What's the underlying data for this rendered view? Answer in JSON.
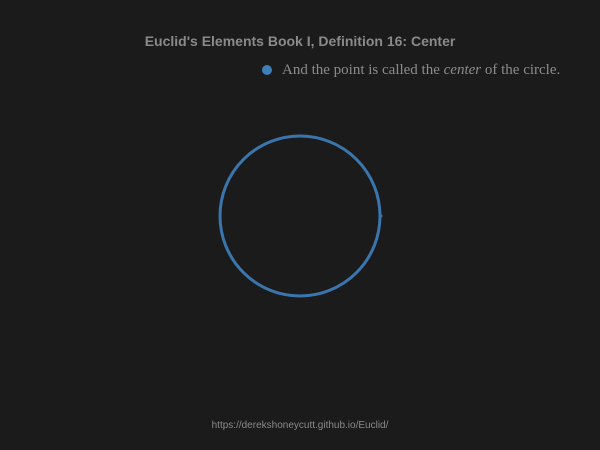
{
  "title": "Euclid's Elements Book I, Definition 16: Center",
  "caption": {
    "before": "And the point is called the ",
    "emphasis": "center",
    "after": " of the circle."
  },
  "footer_url": "https://derekshoneycutt.github.io/Euclid/",
  "colors": {
    "background": "#1b1b1b",
    "accent": "#3f7fb8",
    "circle_stroke": "#3a76ad",
    "text": "#8a8a8a"
  },
  "icons": {
    "bullet": "filled-circle-bullet"
  }
}
